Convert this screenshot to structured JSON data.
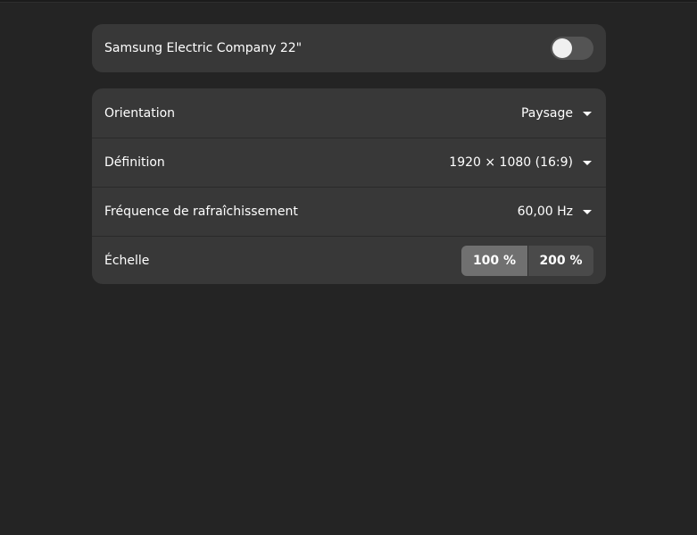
{
  "monitor": {
    "name": "Samsung Electric Company 22\"",
    "enabled": false
  },
  "settings": {
    "orientation": {
      "label": "Orientation",
      "value": "Paysage"
    },
    "resolution": {
      "label": "Définition",
      "value": "1920 × 1080 (16:9)"
    },
    "refresh_rate": {
      "label": "Fréquence de rafraîchissement",
      "value": "60,00 Hz"
    },
    "scale": {
      "label": "Échelle",
      "options": [
        "100 %",
        "200 %"
      ],
      "selected": "100 %"
    }
  },
  "colors": {
    "background": "#242424",
    "card": "#383838",
    "toggle_off": "#545454",
    "segment_active": "#707070",
    "segment_inactive": "#4a4a4a"
  }
}
